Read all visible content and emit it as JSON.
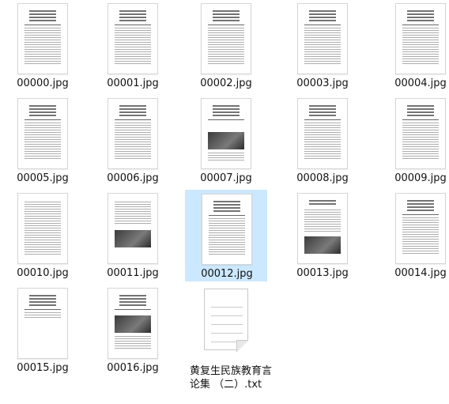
{
  "files": [
    {
      "name": "00000.jpg",
      "kind": "text-page"
    },
    {
      "name": "00001.jpg",
      "kind": "text-page"
    },
    {
      "name": "00002.jpg",
      "kind": "text-page"
    },
    {
      "name": "00003.jpg",
      "kind": "text-page"
    },
    {
      "name": "00004.jpg",
      "kind": "text-page"
    },
    {
      "name": "00005.jpg",
      "kind": "text-page"
    },
    {
      "name": "00006.jpg",
      "kind": "text-page"
    },
    {
      "name": "00007.jpg",
      "kind": "photo-page"
    },
    {
      "name": "00008.jpg",
      "kind": "text-page"
    },
    {
      "name": "00009.jpg",
      "kind": "text-page"
    },
    {
      "name": "00010.jpg",
      "kind": "text-page"
    },
    {
      "name": "00011.jpg",
      "kind": "photo-page"
    },
    {
      "name": "00012.jpg",
      "kind": "text-page",
      "selected": true
    },
    {
      "name": "00013.jpg",
      "kind": "photo-page"
    },
    {
      "name": "00014.jpg",
      "kind": "text-page"
    },
    {
      "name": "00015.jpg",
      "kind": "text-page"
    },
    {
      "name": "00016.jpg",
      "kind": "photo-page"
    }
  ],
  "text_file": {
    "name": "黄复生民族教育言论集 （二）.txt",
    "icon": "text-document-icon"
  },
  "colors": {
    "selection": "#cce8ff"
  }
}
